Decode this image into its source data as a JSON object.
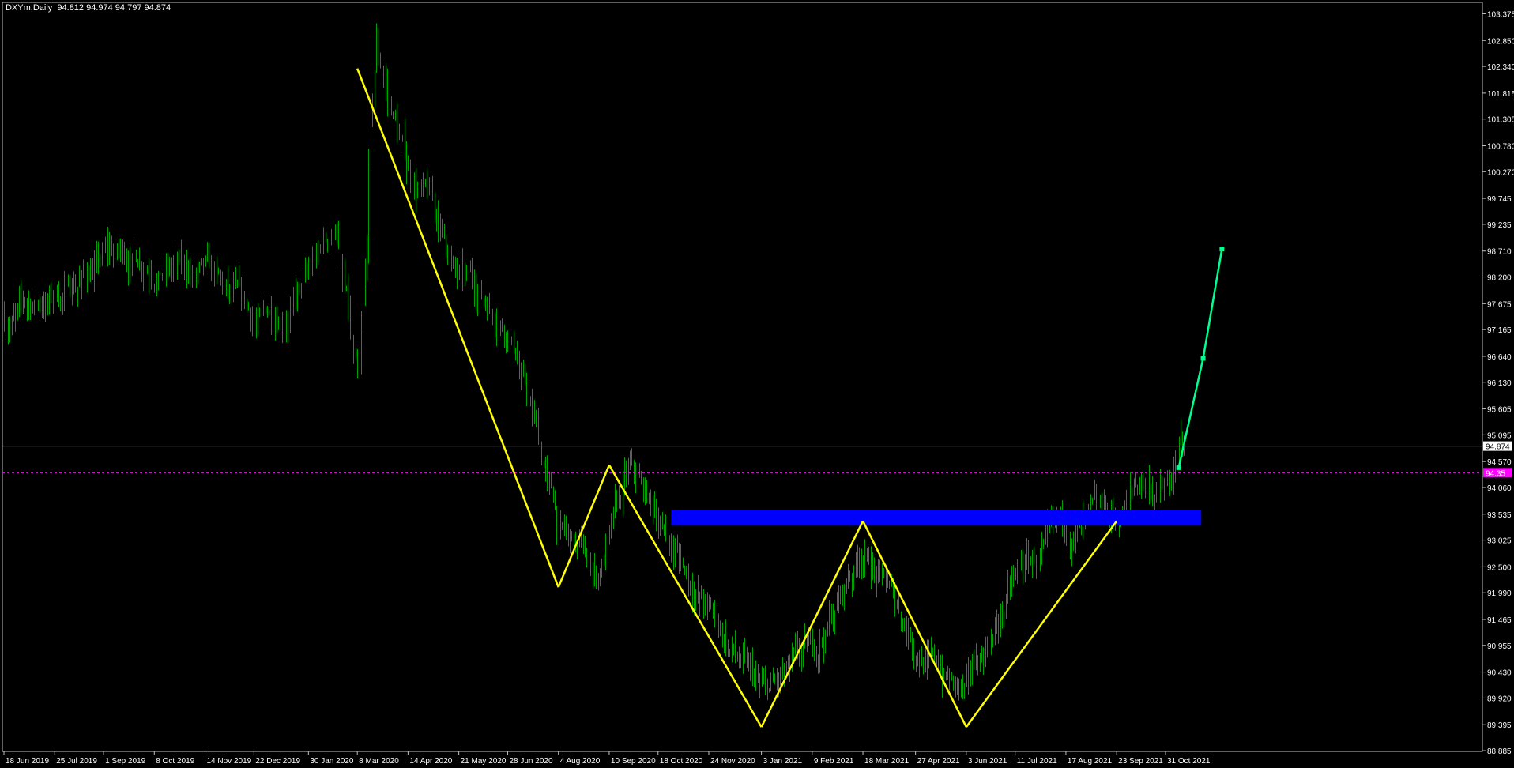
{
  "window": {
    "symbol_info": "DXYm,Daily  94.812 94.974 94.797 94.874"
  },
  "colors": {
    "background": "#000000",
    "frame": "#c0c0c0",
    "bars": "#00a000",
    "pattern_line": "#ffff00",
    "projection_line": "#00ff90",
    "zone": "#0000ff",
    "current_price_line": "#a0a0a0",
    "dashed_line": "#ff00ff",
    "axis_text": "#ffffff"
  },
  "chart_data": {
    "type": "ohlc",
    "timeframe": "Daily",
    "symbol": "DXYm",
    "ylim": [
      88.87,
      103.6
    ],
    "y_ticks": [
      "103.375",
      "102.850",
      "102.340",
      "101.815",
      "101.305",
      "100.780",
      "100.270",
      "99.745",
      "99.235",
      "98.710",
      "98.200",
      "97.675",
      "97.165",
      "96.640",
      "96.130",
      "95.605",
      "95.095",
      "94.570",
      "94.060",
      "93.535",
      "93.025",
      "92.500",
      "91.990",
      "91.465",
      "90.955",
      "90.430",
      "89.920",
      "89.395",
      "88.885"
    ],
    "x_ticks": [
      "18 Jun 2019",
      "25 Jul 2019",
      "1 Sep 2019",
      "8 Oct 2019",
      "14 Nov 2019",
      "22 Dec 2019",
      "30 Jan 2020",
      "8 Mar 2020",
      "14 Apr 2020",
      "21 May 2020",
      "28 Jun 2020",
      "4 Aug 2020",
      "10 Sep 2020",
      "18 Oct 2020",
      "24 Nov 2020",
      "3 Jan 2021",
      "9 Feb 2021",
      "18 Mar 2021",
      "27 Apr 2021",
      "3 Jun 2021",
      "11 Jul 2021",
      "17 Aug 2021",
      "23 Sep 2021",
      "31 Oct 2021"
    ],
    "price_path": [
      [
        "18 Jun 2019",
        97.4
      ],
      [
        "25 Jul 2019",
        97.8
      ],
      [
        "1 Sep 2019",
        98.6
      ],
      [
        "8 Oct 2019",
        98.6
      ],
      [
        "14 Nov 2019",
        98.1
      ],
      [
        "22 Dec 2019",
        97.1
      ],
      [
        "30 Jan 2020",
        98.1
      ],
      [
        "20 Feb 2020",
        99.2
      ],
      [
        "8 Mar 2020",
        95.5
      ],
      [
        "20 Mar 2020",
        102.5
      ],
      [
        "14 Apr 2020",
        100.2
      ],
      [
        "1 May 2020",
        99.6
      ],
      [
        "21 May 2020",
        98.1
      ],
      [
        "28 Jun 2020",
        97.4
      ],
      [
        "4 Aug 2020",
        93.2
      ],
      [
        "1 Sep 2020",
        92.3
      ],
      [
        "25 Sep 2020",
        94.2
      ],
      [
        "18 Oct 2020",
        93.3
      ],
      [
        "24 Nov 2020",
        91.6
      ],
      [
        "3 Jan 2021",
        89.8
      ],
      [
        "9 Feb 2021",
        90.6
      ],
      [
        "18 Mar 2021",
        92.9
      ],
      [
        "27 Apr 2021",
        91.0
      ],
      [
        "3 Jun 2021",
        89.9
      ],
      [
        "11 Jul 2021",
        92.3
      ],
      [
        "17 Aug 2021",
        93.0
      ],
      [
        "23 Sep 2021",
        93.3
      ],
      [
        "12 Oct 2021",
        94.2
      ],
      [
        "31 Oct 2021",
        93.9
      ],
      [
        "12 Nov 2021",
        94.874
      ]
    ],
    "current_price": {
      "value": 94.874,
      "label": "94.874"
    },
    "second_price": {
      "value": 94.35,
      "label": "94.35"
    },
    "pattern_zigzag": [
      [
        "8 Mar 2020",
        102.3
      ],
      [
        "4 Aug 2020",
        92.1
      ],
      [
        "10 Sep 2020",
        94.5
      ],
      [
        "3 Jan 2021",
        89.35
      ],
      [
        "18 Mar 2021",
        93.4
      ],
      [
        "3 Jun 2021",
        89.35
      ],
      [
        "23 Sep 2021",
        93.4
      ]
    ],
    "projection": [
      [
        "9 Nov 2021",
        94.45
      ],
      [
        "26 Nov 2021",
        96.6
      ],
      [
        "10 Dec 2021",
        98.75
      ]
    ],
    "zone": {
      "x_start": "27 Oct 2020",
      "x_end": "25 Nov 2021",
      "y_low": 93.32,
      "y_high": 93.62
    },
    "grid": false
  }
}
